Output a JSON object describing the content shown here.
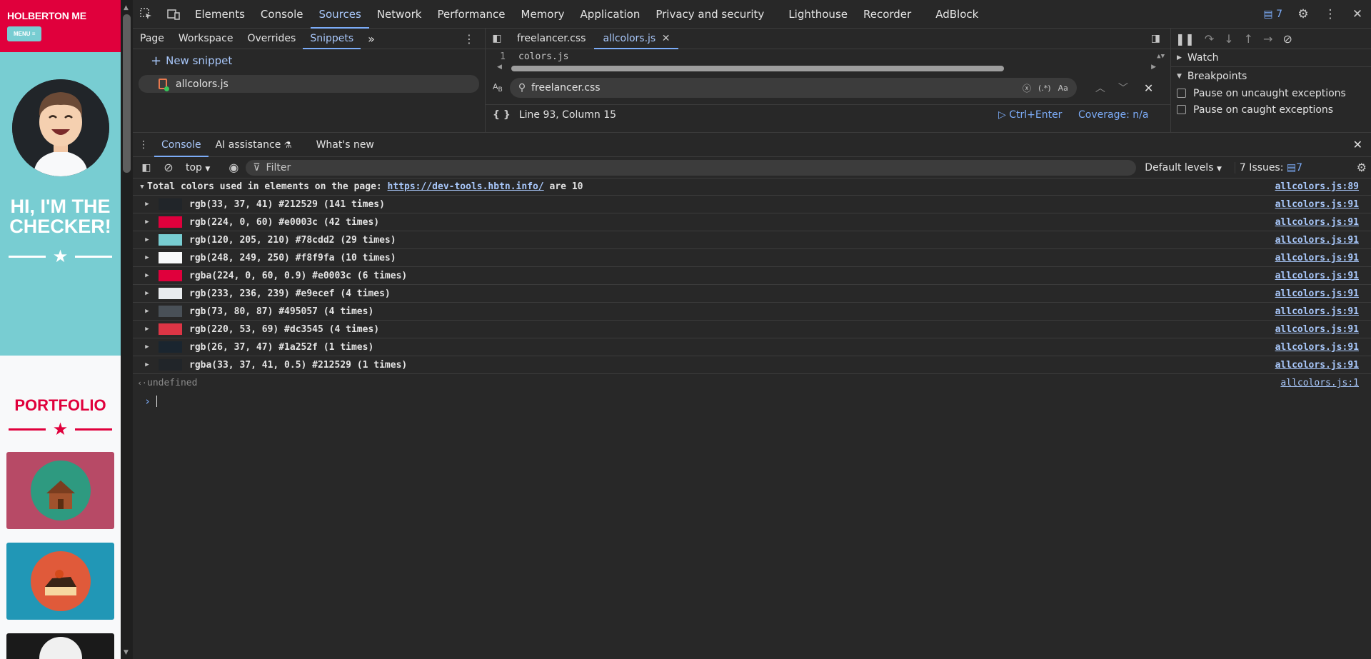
{
  "site": {
    "brand": "HOLBERTON ME",
    "menu": "MENU ≡",
    "hero_title": "HI, I'M THE CHECKER!",
    "portfolio_title": "PORTFOLIO"
  },
  "devtools": {
    "main_tabs": [
      "Elements",
      "Console",
      "Sources",
      "Network",
      "Performance",
      "Memory",
      "Application",
      "Privacy and security",
      "Lighthouse",
      "Recorder",
      "AdBlock"
    ],
    "active_main_tab": "Sources",
    "issues_count": "7",
    "navigator": {
      "tabs": [
        "Page",
        "Workspace",
        "Overrides",
        "Snippets"
      ],
      "active": "Snippets",
      "new_snippet": "New snippet",
      "snippets": [
        "allcolors.js"
      ]
    },
    "editor": {
      "tabs": [
        "freelancer.css",
        "allcolors.js"
      ],
      "active": "allcolors.js",
      "line_number": "1",
      "line_text": "colors.js",
      "search_value": "freelancer.css",
      "regex_label": "(.*)",
      "case_label": "Aa",
      "position": "Line 93, Column 15",
      "run_label": "Ctrl+Enter",
      "coverage": "Coverage: n/a"
    },
    "debugger": {
      "watch": "Watch",
      "breakpoints": "Breakpoints",
      "pause_uncaught": "Pause on uncaught exceptions",
      "pause_caught": "Pause on caught exceptions"
    },
    "drawer": {
      "tabs": [
        "Console",
        "AI assistance",
        "What's new"
      ],
      "active": "Console",
      "context": "top",
      "filter_placeholder": "Filter",
      "levels": "Default levels",
      "issues": "7 Issues:",
      "issues_count": "7"
    },
    "console": {
      "group_prefix": "Total colors used in elements on the page: ",
      "group_link": "https://dev-tools.hbtn.info/",
      "group_suffix": " are 10",
      "group_source": "allcolors.js:89",
      "entries": [
        {
          "text": "rgb(33, 37, 41) #212529 (141 times)",
          "color": "#212529",
          "source": "allcolors.js:91"
        },
        {
          "text": "rgb(224, 0, 60) #e0003c (42 times)",
          "color": "#e0003c",
          "source": "allcolors.js:91"
        },
        {
          "text": "rgb(120, 205, 210) #78cdd2 (29 times)",
          "color": "#78cdd2",
          "source": "allcolors.js:91"
        },
        {
          "text": "rgb(248, 249, 250) #f8f9fa (10 times)",
          "color": "#f8f9fa",
          "source": "allcolors.js:91"
        },
        {
          "text": "rgba(224, 0, 60, 0.9) #e0003c (6 times)",
          "color": "#e0003c",
          "source": "allcolors.js:91"
        },
        {
          "text": "rgb(233, 236, 239) #e9ecef (4 times)",
          "color": "#e9ecef",
          "source": "allcolors.js:91"
        },
        {
          "text": "rgb(73, 80, 87) #495057 (4 times)",
          "color": "#495057",
          "source": "allcolors.js:91"
        },
        {
          "text": "rgb(220, 53, 69) #dc3545 (4 times)",
          "color": "#dc3545",
          "source": "allcolors.js:91"
        },
        {
          "text": "rgb(26, 37, 47) #1a252f (1 times)",
          "color": "#1a252f",
          "source": "allcolors.js:91"
        },
        {
          "text": "rgba(33, 37, 41, 0.5) #212529 (1 times)",
          "color": "#212529",
          "source": "allcolors.js:91"
        }
      ],
      "result_text": "undefined",
      "result_source": "allcolors.js:1"
    }
  }
}
